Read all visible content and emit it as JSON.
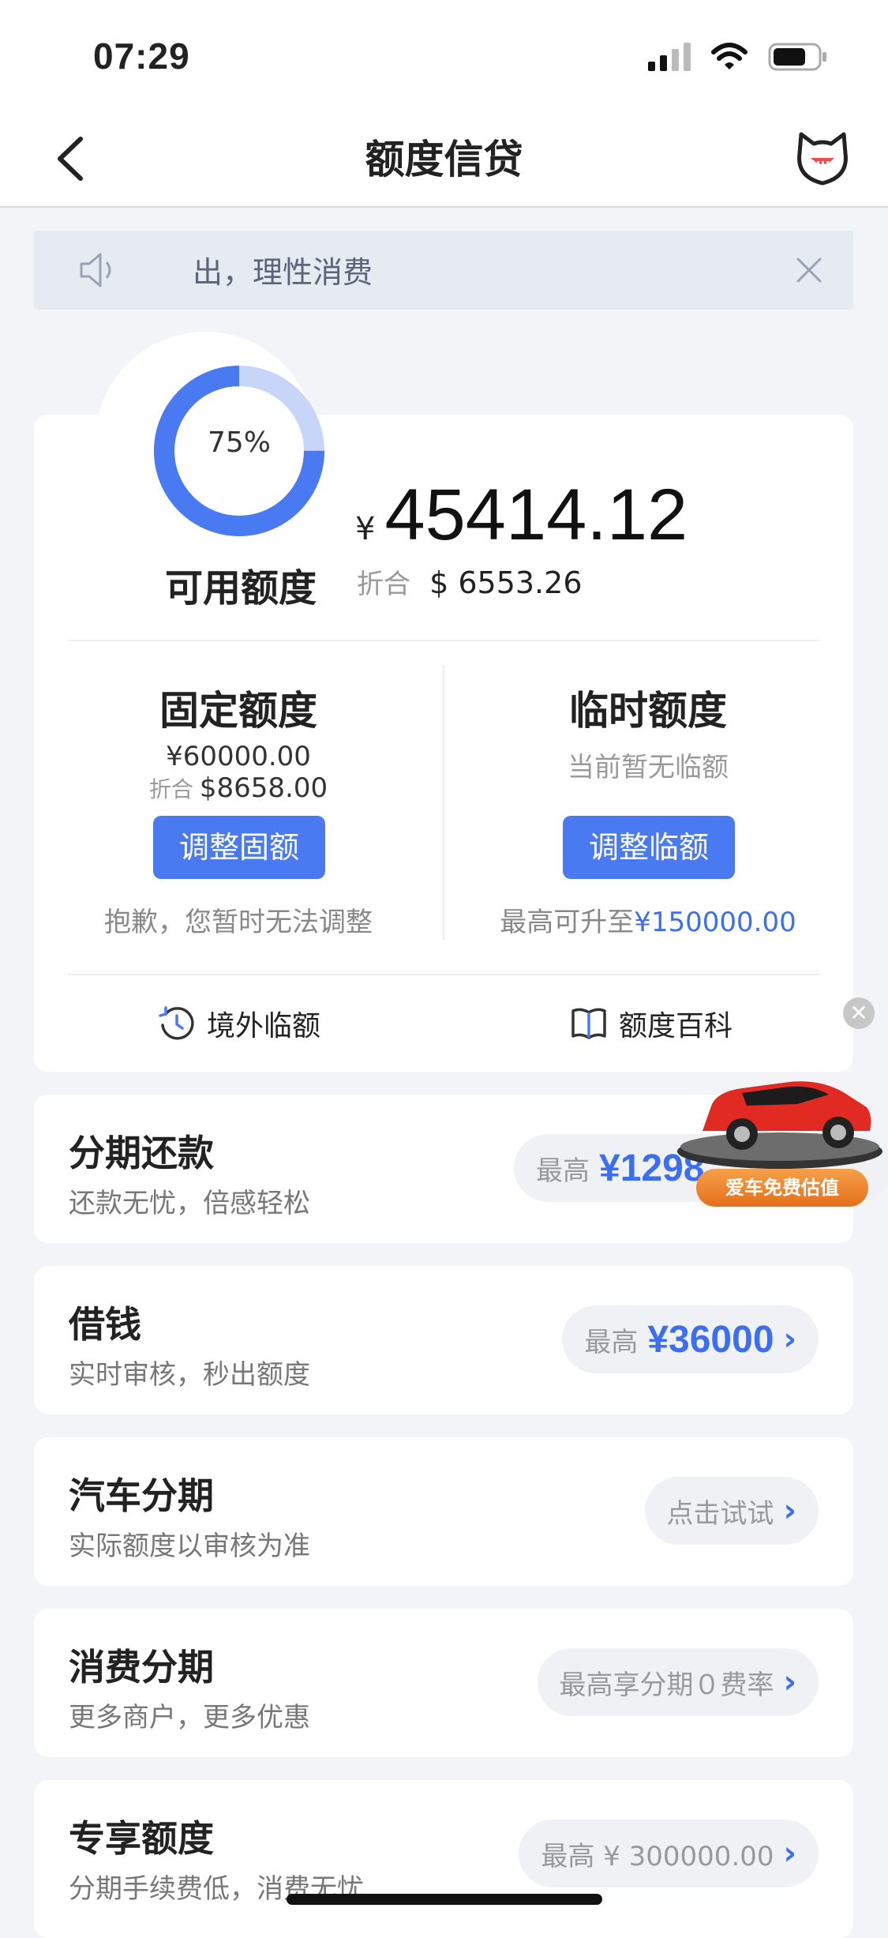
{
  "status": {
    "time": "07:29"
  },
  "nav": {
    "title": "额度信贷"
  },
  "notice": {
    "text": "ﾠ出，理性消费"
  },
  "summary": {
    "ring_percent_label": "75%",
    "ring_fraction": 0.75,
    "available_label": "可用额度",
    "currency_symbol": "¥",
    "available_amount": "45414.12",
    "equiv_label": "折合",
    "equiv_amount": "$ 6553.26"
  },
  "fixed": {
    "title": "固定额度",
    "amount": "¥60000.00",
    "equiv_label": "折合",
    "equiv_amount": "$8658.00",
    "button": "调整固额",
    "hint": "抱歉，您暂时无法调整"
  },
  "temp": {
    "title": "临时额度",
    "status": "当前暂无临额",
    "button": "调整临额",
    "hint_prefix": "最高可升至",
    "hint_amount": "¥150000.00"
  },
  "links": {
    "overseas": "境外临额",
    "wiki": "额度百科"
  },
  "rows": [
    {
      "title": "分期还款",
      "sub": "还款无忧，倍感轻松",
      "pill_label": "最高",
      "pill_value": "¥1298"
    },
    {
      "title": "借钱",
      "sub": "实时审核，秒出额度",
      "pill_label": "最高",
      "pill_value": "¥36000"
    },
    {
      "title": "汽车分期",
      "sub": "实际额度以审核为准",
      "pill_label": "点击试试",
      "pill_value": ""
    },
    {
      "title": "消费分期",
      "sub": "更多商户，更多优惠",
      "pill_label": "最高享分期０费率",
      "pill_value": ""
    },
    {
      "title": "专享额度",
      "sub": "分期手续费低，消费无忧",
      "pill_label": "最高 ¥ 300000.00",
      "pill_value": ""
    }
  ],
  "ad": {
    "label": "爱车免费估值"
  },
  "colors": {
    "primary": "#4a7af1",
    "ring_light": "#c7d6f8",
    "bg": "#f3f4f8"
  }
}
